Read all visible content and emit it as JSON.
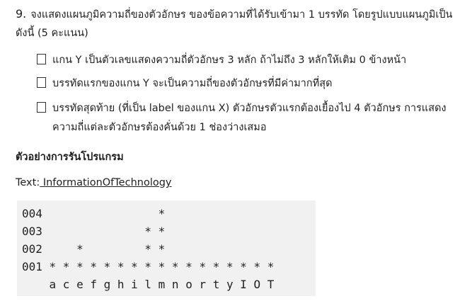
{
  "question": {
    "number": "9.",
    "line1": "จงแสดงแผนภูมิความถี่ของตัวอักษร ของข้อความที่ได้รับเข้ามา 1 บรรทัด โดยรูปแบบแผนภูมิเป็น",
    "line2": "ดังนี้ (5 คะแนน)"
  },
  "criteria": [
    {
      "text": "แกน Y เป็นตัวเลขแสดงความถี่ตัวอักษร 3 หลัก ถ้าไม่ถึง 3 หลักให้เติม 0 ข้างหน้า"
    },
    {
      "text": "บรรทัดแรกของแกน Y จะเป็นความถี่ของตัวอักษรที่มีค่ามากที่สุด"
    },
    {
      "text": "บรรทัดสุดท้าย (ที่เป็น label ของแกน X) ตัวอักษรตัวแรกต้องเยื้องไป 4 ตัวอักษร การแสดง",
      "continuation": "ความถี่แต่ละตัวอักษรต้องคั่นด้วย 1 ช่องว่างเสมอ"
    }
  ],
  "example": {
    "heading": "ตัวอย่างการรันโปรแกรม",
    "text_label": "Text:",
    "text_value": " InformationOfTechnology",
    "output_lines": [
      "004                 *",
      "003               * *",
      "002     *         * *",
      "001 * * * * * * * * * * * * * * * * *",
      "    a c e f g h i l m n o r t y I O T"
    ]
  }
}
